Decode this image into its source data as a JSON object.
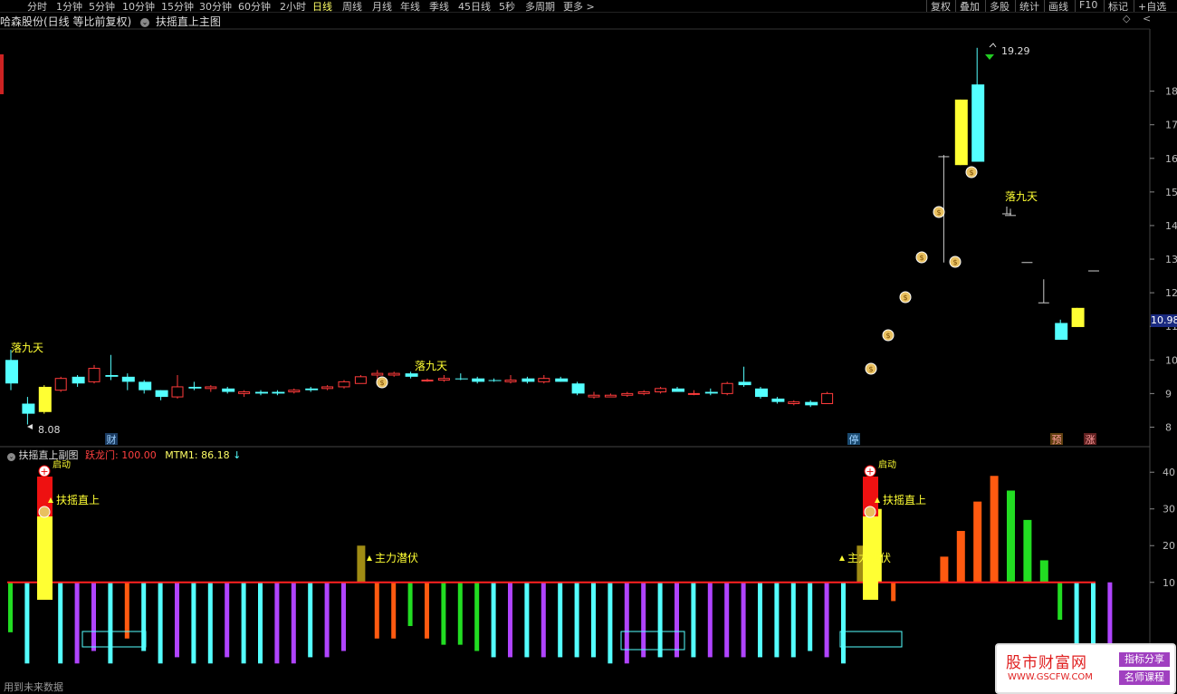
{
  "toolbar": {
    "tabs": [
      "分时",
      "1分钟",
      "5分钟",
      "10分钟",
      "15分钟",
      "30分钟",
      "60分钟",
      "2小时",
      "日线",
      "周线",
      "月线",
      "年线",
      "季线",
      "45日线",
      "5秒",
      "多周期",
      "更多 >"
    ],
    "active_tab": "日线",
    "right_tabs": [
      "复权",
      "叠加",
      "多股",
      "统计",
      "画线",
      "F10",
      "标记",
      "+自选"
    ]
  },
  "main_panel": {
    "stock_title": "哈森股份(日线 等比前复权)",
    "indicator_name": "扶摇直上主图",
    "current_price": "10.98",
    "high_label": "19.29",
    "low_label": "8.08",
    "signal_luojiutian": "落九天",
    "markers": [
      "财",
      "停",
      "预",
      "涨"
    ],
    "y_axis_ticks": [
      "18",
      "17",
      "16",
      "15",
      "14",
      "13",
      "12",
      "11",
      "10",
      "9",
      "8"
    ]
  },
  "sub_panel": {
    "title": "扶摇直上副图",
    "line1_label": "跃龙门:",
    "line1_value": "100.00",
    "line2_label": "MTM1:",
    "line2_value": "86.18",
    "arrow": "↓",
    "signal_fuyao": "扶摇直上",
    "signal_zhuli": "主力潜伏",
    "signal_qidong": "启动",
    "y_axis_ticks": [
      "40",
      "30",
      "20",
      "10"
    ]
  },
  "colors": {
    "up": "#ff3b3b",
    "down": "#54ffff",
    "yellow": "#ffff33",
    "purple": "#b044ff",
    "orange": "#ff5a10",
    "green": "#22dd22",
    "olive": "#a08c14",
    "zeroline": "#ff2020"
  },
  "footer": "用到未来数据",
  "watermark": {
    "main": "股市财富网",
    "url": "WWW.GSCFW.COM",
    "badge1": "指标分享",
    "badge2": "名师课程"
  },
  "chart_data": {
    "type": "candlestick",
    "title": "哈森股份(日线 等比前复权)",
    "ylim": [
      7.5,
      19.5
    ],
    "candles": [
      {
        "o": 10.0,
        "h": 10.3,
        "l": 9.1,
        "c": 9.3,
        "k": "d"
      },
      {
        "o": 8.7,
        "h": 8.9,
        "l": 8.08,
        "c": 8.4,
        "k": "d"
      },
      {
        "o": 8.45,
        "h": 9.25,
        "l": 8.4,
        "c": 9.2,
        "k": "y"
      },
      {
        "o": 9.1,
        "h": 9.5,
        "l": 9.05,
        "c": 9.45,
        "k": "u"
      },
      {
        "o": 9.5,
        "h": 9.55,
        "l": 9.2,
        "c": 9.3,
        "k": "d"
      },
      {
        "o": 9.35,
        "h": 9.85,
        "l": 9.3,
        "c": 9.75,
        "k": "u"
      },
      {
        "o": 9.55,
        "h": 10.15,
        "l": 9.4,
        "c": 9.5,
        "k": "d"
      },
      {
        "o": 9.5,
        "h": 9.6,
        "l": 9.1,
        "c": 9.35,
        "k": "d"
      },
      {
        "o": 9.35,
        "h": 9.4,
        "l": 9.0,
        "c": 9.1,
        "k": "d"
      },
      {
        "o": 9.1,
        "h": 9.1,
        "l": 8.8,
        "c": 8.9,
        "k": "d"
      },
      {
        "o": 8.9,
        "h": 9.55,
        "l": 8.85,
        "c": 9.2,
        "k": "u"
      },
      {
        "o": 9.2,
        "h": 9.35,
        "l": 9.1,
        "c": 9.15,
        "k": "d"
      },
      {
        "o": 9.15,
        "h": 9.25,
        "l": 9.05,
        "c": 9.2,
        "k": "u"
      },
      {
        "o": 9.15,
        "h": 9.2,
        "l": 9.0,
        "c": 9.05,
        "k": "d"
      },
      {
        "o": 9.0,
        "h": 9.1,
        "l": 8.9,
        "c": 9.05,
        "k": "u"
      },
      {
        "o": 9.05,
        "h": 9.1,
        "l": 8.95,
        "c": 9.0,
        "k": "d"
      },
      {
        "o": 9.0,
        "h": 9.1,
        "l": 8.95,
        "c": 9.05,
        "k": "d"
      },
      {
        "o": 9.05,
        "h": 9.15,
        "l": 9.0,
        "c": 9.1,
        "k": "u"
      },
      {
        "o": 9.1,
        "h": 9.2,
        "l": 9.05,
        "c": 9.15,
        "k": "d"
      },
      {
        "o": 9.15,
        "h": 9.25,
        "l": 9.1,
        "c": 9.2,
        "k": "u"
      },
      {
        "o": 9.2,
        "h": 9.4,
        "l": 9.15,
        "c": 9.35,
        "k": "u"
      },
      {
        "o": 9.3,
        "h": 9.55,
        "l": 9.3,
        "c": 9.5,
        "k": "u"
      },
      {
        "o": 9.55,
        "h": 9.7,
        "l": 9.4,
        "c": 9.6,
        "k": "u"
      },
      {
        "o": 9.55,
        "h": 9.65,
        "l": 9.5,
        "c": 9.6,
        "k": "u"
      },
      {
        "o": 9.6,
        "h": 9.65,
        "l": 9.45,
        "c": 9.5,
        "k": "d"
      },
      {
        "o": 9.4,
        "h": 9.45,
        "l": 9.35,
        "c": 9.4,
        "k": "u"
      },
      {
        "o": 9.4,
        "h": 9.55,
        "l": 9.35,
        "c": 9.45,
        "k": "u"
      },
      {
        "o": 9.45,
        "h": 9.6,
        "l": 9.4,
        "c": 9.45,
        "k": "d"
      },
      {
        "o": 9.45,
        "h": 9.5,
        "l": 9.3,
        "c": 9.35,
        "k": "d"
      },
      {
        "o": 9.4,
        "h": 9.45,
        "l": 9.35,
        "c": 9.4,
        "k": "d"
      },
      {
        "o": 9.35,
        "h": 9.55,
        "l": 9.3,
        "c": 9.4,
        "k": "u"
      },
      {
        "o": 9.45,
        "h": 9.5,
        "l": 9.3,
        "c": 9.35,
        "k": "d"
      },
      {
        "o": 9.35,
        "h": 9.55,
        "l": 9.3,
        "c": 9.45,
        "k": "u"
      },
      {
        "o": 9.45,
        "h": 9.5,
        "l": 9.35,
        "c": 9.35,
        "k": "d"
      },
      {
        "o": 9.3,
        "h": 9.35,
        "l": 8.95,
        "c": 9.0,
        "k": "d"
      },
      {
        "o": 8.95,
        "h": 9.05,
        "l": 8.85,
        "c": 8.9,
        "k": "u"
      },
      {
        "o": 8.9,
        "h": 9.0,
        "l": 8.9,
        "c": 8.95,
        "k": "u"
      },
      {
        "o": 8.95,
        "h": 9.05,
        "l": 8.9,
        "c": 9.0,
        "k": "u"
      },
      {
        "o": 9.0,
        "h": 9.1,
        "l": 8.95,
        "c": 9.05,
        "k": "u"
      },
      {
        "o": 9.05,
        "h": 9.2,
        "l": 9.0,
        "c": 9.15,
        "k": "u"
      },
      {
        "o": 9.15,
        "h": 9.2,
        "l": 9.05,
        "c": 9.05,
        "k": "d"
      },
      {
        "o": 9.0,
        "h": 9.1,
        "l": 8.95,
        "c": 9.0,
        "k": "u"
      },
      {
        "o": 9.05,
        "h": 9.15,
        "l": 8.95,
        "c": 9.0,
        "k": "d"
      },
      {
        "o": 9.0,
        "h": 9.35,
        "l": 8.95,
        "c": 9.3,
        "k": "u"
      },
      {
        "o": 9.35,
        "h": 9.8,
        "l": 9.2,
        "c": 9.25,
        "k": "d"
      },
      {
        "o": 9.15,
        "h": 9.2,
        "l": 8.85,
        "c": 8.9,
        "k": "d"
      },
      {
        "o": 8.85,
        "h": 8.9,
        "l": 8.7,
        "c": 8.75,
        "k": "d"
      },
      {
        "o": 8.7,
        "h": 8.8,
        "l": 8.65,
        "c": 8.75,
        "k": "u"
      },
      {
        "o": 8.75,
        "h": 8.8,
        "l": 8.6,
        "c": 8.65,
        "k": "d"
      },
      {
        "o": 8.7,
        "h": 9.05,
        "l": 8.7,
        "c": 9.0,
        "k": "u"
      },
      null,
      null,
      null,
      null,
      null,
      null,
      {
        "o": 10.2,
        "h": 16.1,
        "l": 12.9,
        "c": 16.05,
        "k": "line"
      },
      {
        "o": 15.8,
        "h": 17.75,
        "l": 15.8,
        "c": 17.75,
        "k": "y"
      },
      {
        "o": 15.9,
        "h": 19.29,
        "l": 15.9,
        "c": 18.2,
        "k": "d"
      },
      null,
      {
        "o": 14.3,
        "h": 14.5,
        "l": 14.3,
        "c": 14.3,
        "k": "line"
      },
      {
        "o": 12.9,
        "h": 12.9,
        "l": 12.9,
        "c": 12.9,
        "k": "line"
      },
      {
        "o": 11.7,
        "h": 12.4,
        "l": 11.7,
        "c": 11.7,
        "k": "line"
      },
      {
        "o": 10.6,
        "h": 11.2,
        "l": 10.6,
        "c": 11.1,
        "k": "d"
      },
      {
        "o": 10.98,
        "h": 11.55,
        "l": 10.98,
        "c": 11.55,
        "k": "y"
      },
      {
        "o": 12.65,
        "h": 12.65,
        "l": 12.65,
        "c": 12.65,
        "k": "line"
      }
    ],
    "sub_bars": [
      -8,
      -13,
      30,
      -13,
      -13,
      -11,
      -13,
      -9,
      -11,
      -13,
      -12,
      -13,
      -13,
      -12,
      -13,
      -13,
      -13,
      -13,
      -12,
      -12,
      -11,
      20,
      -9,
      -9,
      -7,
      -9,
      -10,
      -10,
      -11,
      -12,
      -12,
      -12,
      -12,
      -12,
      -12,
      -12,
      -13,
      -13,
      -12,
      -12,
      -12,
      -12,
      -12,
      -12,
      -12,
      -12,
      -12,
      -12,
      -11,
      -12,
      -13,
      20,
      30,
      -3,
      5,
      10,
      17,
      24,
      32,
      39,
      35,
      27,
      16,
      -6,
      -11,
      -11,
      -12
    ],
    "sub_ylim": [
      -14,
      44
    ]
  }
}
